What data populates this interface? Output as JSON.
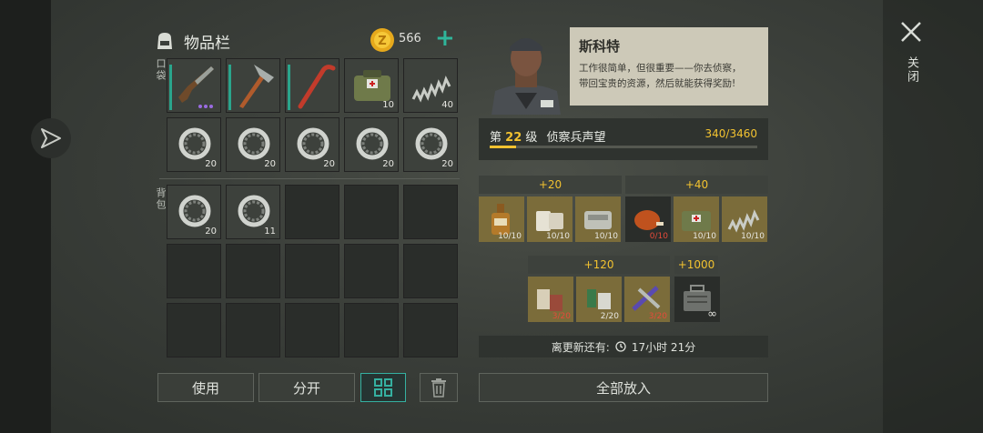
{
  "inventory": {
    "title": "物品栏",
    "coins": "566",
    "pocket_label": "口袋",
    "backpack_label": "背包",
    "pocket_row1": [
      {
        "name": "shotgun",
        "count": "",
        "durability": true,
        "dots": 3
      },
      {
        "name": "hatchet",
        "count": "",
        "durability": true,
        "dots": 0
      },
      {
        "name": "crowbar",
        "count": "",
        "durability": true,
        "dots": 0
      },
      {
        "name": "medkit-bag",
        "count": "10",
        "durability": false,
        "dots": 0
      },
      {
        "name": "spring",
        "count": "40",
        "durability": false,
        "dots": 0
      }
    ],
    "pocket_row2": [
      "20",
      "20",
      "20",
      "20",
      "20"
    ],
    "backpack_items": [
      "20",
      "11"
    ],
    "buttons": {
      "use": "使用",
      "split": "分开"
    }
  },
  "npc": {
    "name": "斯科特",
    "text_line1": "工作很简单，但很重要——你去侦察，",
    "text_line2": "带回宝贵的资源，然后就能获得奖励!"
  },
  "level": {
    "prefix": "第",
    "number": "22",
    "suffix": "级",
    "title": "侦察兵声望",
    "progress": "340/3460",
    "progress_fraction": 0.098
  },
  "rewards": {
    "group1": {
      "bonus": "+20",
      "items": [
        "10/10",
        "10/10",
        "10/10"
      ]
    },
    "group2": {
      "bonus": "+40",
      "items": [
        "0/10",
        "10/10",
        "10/10"
      ]
    },
    "group3": {
      "bonus": "+120",
      "items": [
        "3/20",
        "2/20",
        "3/20"
      ]
    },
    "group4": {
      "bonus": "+1000",
      "items": [
        "∞"
      ]
    }
  },
  "timer": {
    "label": "离更新还有:",
    "value": "17小时 21分"
  },
  "put_all": "全部放入",
  "close_label": "关闭",
  "colors": {
    "accent_teal": "#2fb59a",
    "gold": "#f2c230",
    "reward_slot": "#7b6c3a",
    "dark_slot": "#2a2d2a"
  }
}
